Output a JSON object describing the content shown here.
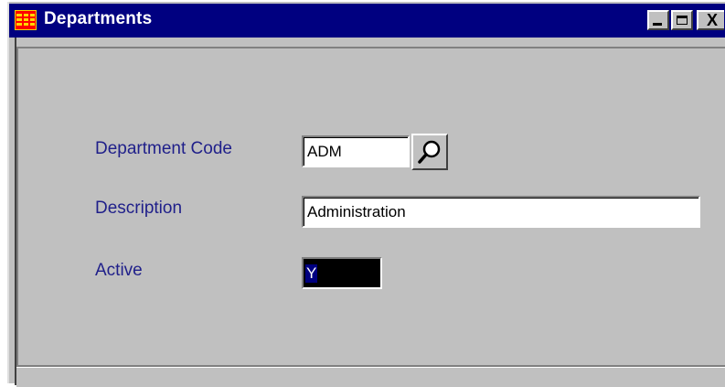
{
  "window": {
    "title": "Departments",
    "icon": "app-grid-icon",
    "controls": {
      "minimize": "minimize-icon",
      "maximize": "maximize-icon",
      "close": "close-icon",
      "close_glyph": "X"
    }
  },
  "form": {
    "department_code": {
      "label": "Department Code",
      "value": "ADM",
      "lookup_icon": "magnifier-icon"
    },
    "description": {
      "label": "Description",
      "value": "Administration"
    },
    "active": {
      "label": "Active",
      "value": "Y"
    }
  },
  "colors": {
    "titlebar": "#000080",
    "window_bg": "#c0c0c0",
    "label_text": "#1f1f8a",
    "active_field_bg": "#000000",
    "selection_bg": "#000080"
  }
}
